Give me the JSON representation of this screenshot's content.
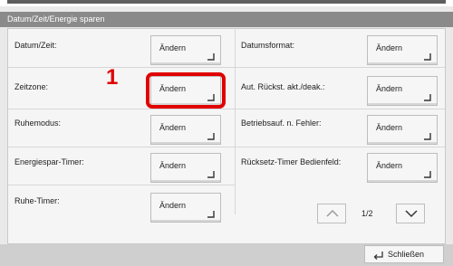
{
  "window": {
    "title": "Datum/Zeit/Energie sparen"
  },
  "left_items": [
    {
      "label": "Datum/Zeit:",
      "button": "Ändern"
    },
    {
      "label": "Zeitzone:",
      "button": "Ändern"
    },
    {
      "label": "Ruhemodus:",
      "button": "Ändern"
    },
    {
      "label": "Energiespar-Timer:",
      "button": "Ändern"
    },
    {
      "label": "Ruhe-Timer:",
      "button": "Ändern"
    }
  ],
  "right_items": [
    {
      "label": "Datumsformat:",
      "button": "Ändern"
    },
    {
      "label": "Aut. Rückst. akt./deak.:",
      "button": "Ändern"
    },
    {
      "label": "Betriebsauf. n. Fehler:",
      "button": "Ändern"
    },
    {
      "label": "Rücksetz-Timer Bedienfeld:",
      "button": "Ändern"
    }
  ],
  "step_marker": "1",
  "pagination": {
    "page": "1/2"
  },
  "footer": {
    "close_label": "Schließen"
  },
  "colors": {
    "highlight": "#e00000",
    "titlebar": "#8a8a8a"
  },
  "icons": {
    "arrow": "corner-arrow-icon",
    "up": "chevron-up-icon",
    "down": "chevron-down-icon",
    "close": "return-arrow-icon"
  }
}
